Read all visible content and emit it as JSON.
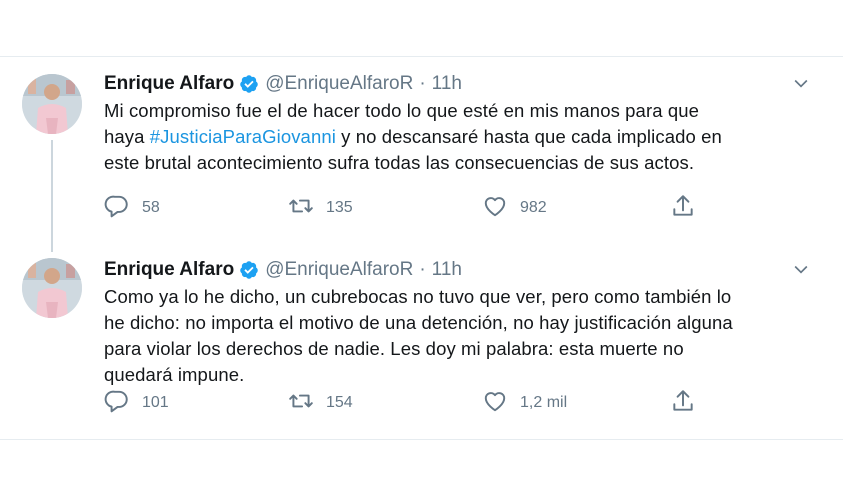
{
  "colors": {
    "text": "#14171a",
    "secondary": "#657786",
    "link": "#1b95e0",
    "verified": "#1da1f2",
    "border": "#e6ecf0"
  },
  "tweets": [
    {
      "author": "Enrique Alfaro",
      "handle": "@EnriqueAlfaroR",
      "separator": "·",
      "time": "11h",
      "verified_icon": "verified-badge-icon",
      "text_lines": [
        [
          "Mi compromiso fue el de hacer todo lo que esté en mis manos para que"
        ],
        [
          "haya ",
          "#JusticiaParaGiovanni",
          " y no descansaré hasta que cada implicado en"
        ],
        [
          "este brutal acontecimiento sufra todas las consecuencias de sus actos."
        ]
      ],
      "replies": "58",
      "retweets": "135",
      "likes": "982"
    },
    {
      "author": "Enrique Alfaro",
      "handle": "@EnriqueAlfaroR",
      "separator": "·",
      "time": "11h",
      "verified_icon": "verified-badge-icon",
      "text_lines": [
        [
          "Como ya lo he dicho, un cubrebocas no tuvo que ver, pero como también lo"
        ],
        [
          "he dicho: no importa el motivo de una detención, no hay justificación alguna"
        ],
        [
          "para violar los derechos de nadie. Les doy mi palabra: esta muerte no"
        ],
        [
          "quedará impune."
        ]
      ],
      "replies": "101",
      "retweets": "154",
      "likes": "1,2 mil"
    }
  ]
}
